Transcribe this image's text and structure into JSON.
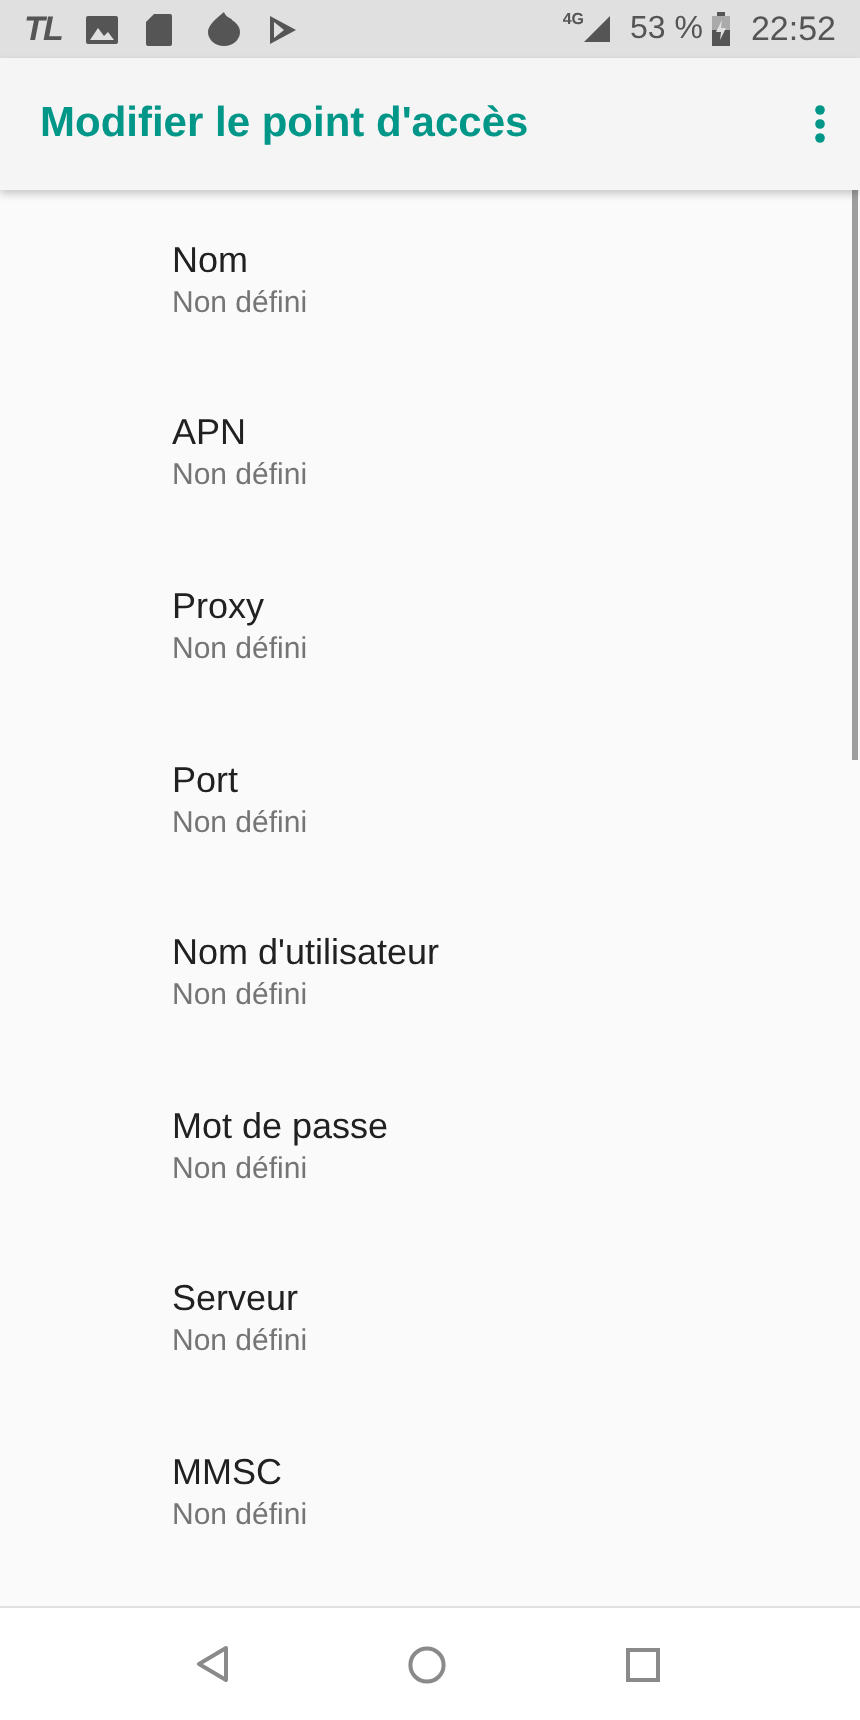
{
  "status_bar": {
    "app_label": "TL",
    "network": "4G",
    "battery": "53 %",
    "time": "22:52"
  },
  "app_bar": {
    "title": "Modifier le point d'accès"
  },
  "settings": [
    {
      "title": "Nom",
      "value": "Non défini"
    },
    {
      "title": "APN",
      "value": "Non défini"
    },
    {
      "title": "Proxy",
      "value": "Non défini"
    },
    {
      "title": "Port",
      "value": "Non défini"
    },
    {
      "title": "Nom d'utilisateur",
      "value": "Non défini"
    },
    {
      "title": "Mot de passe",
      "value": "Non défini"
    },
    {
      "title": "Serveur",
      "value": "Non défini"
    },
    {
      "title": "MMSC",
      "value": "Non défini"
    }
  ]
}
